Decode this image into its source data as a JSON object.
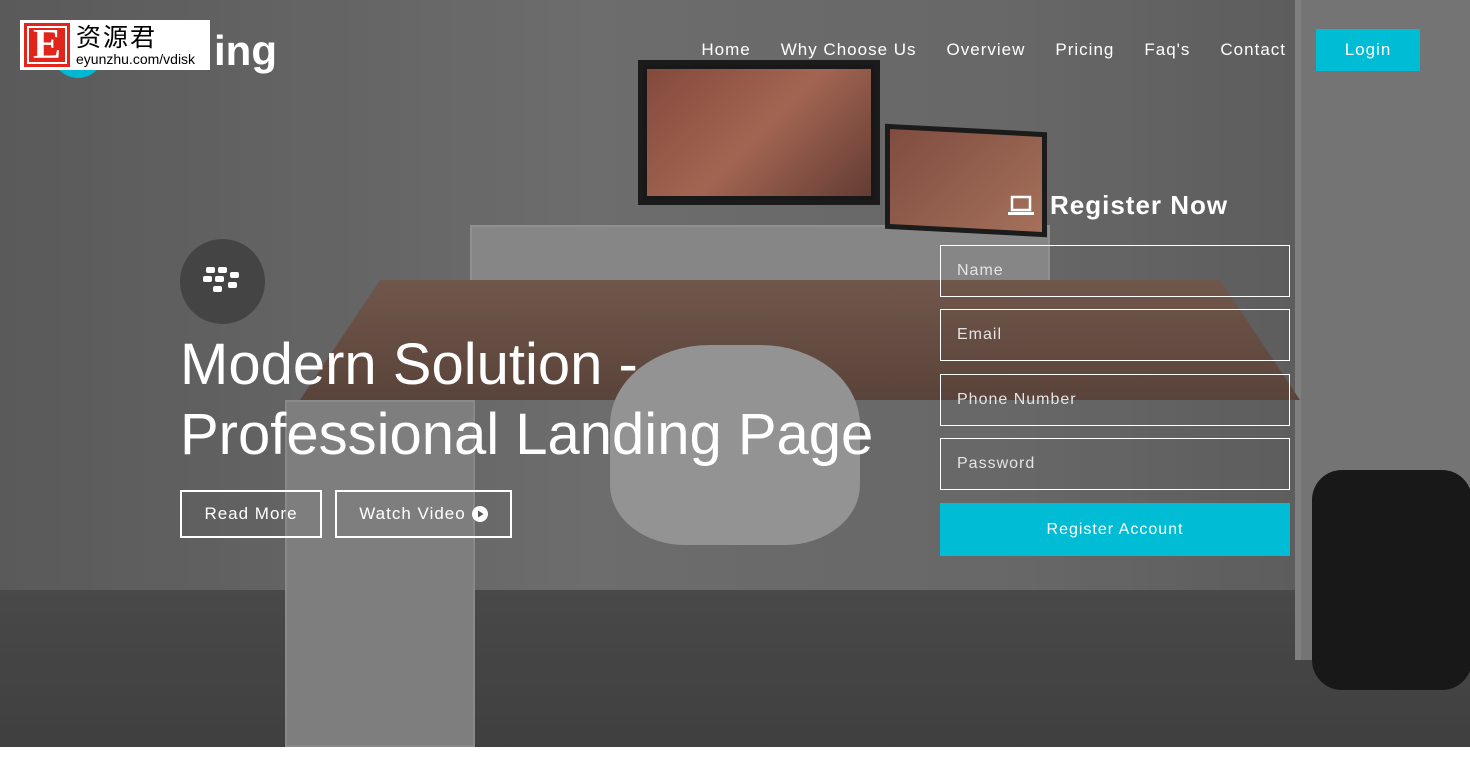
{
  "brand": {
    "logo_text": "ing",
    "accent": "#00bcd4"
  },
  "watermark": {
    "letter": "E",
    "chinese": "资源君",
    "url": "eyunzhu.com/vdisk"
  },
  "nav": {
    "items": [
      "Home",
      "Why Choose Us",
      "Overview",
      "Pricing",
      "Faq's",
      "Contact"
    ],
    "login": "Login"
  },
  "hero": {
    "icon": "blackberry-icon",
    "title_line1": "Modern Solution -",
    "title_line2": "Professional Landing Page",
    "read_more": "Read More",
    "watch_video": "Watch Video"
  },
  "form": {
    "icon": "laptop-icon",
    "title": "Register Now",
    "name_placeholder": "Name",
    "email_placeholder": "Email",
    "phone_placeholder": "Phone Number",
    "password_placeholder": "Password",
    "submit": "Register Account"
  }
}
